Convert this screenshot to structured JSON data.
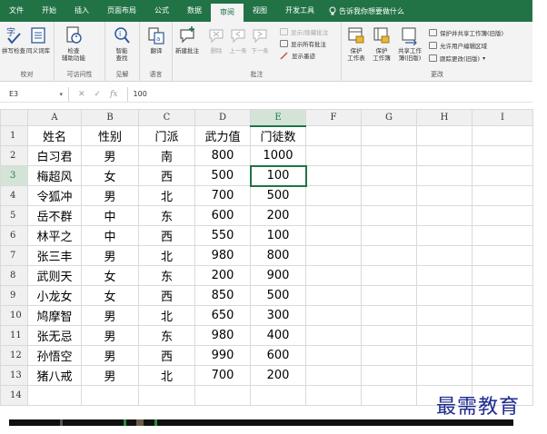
{
  "tabs": [
    "文件",
    "开始",
    "插入",
    "页面布局",
    "公式",
    "数据",
    "审阅",
    "视图",
    "开发工具"
  ],
  "active_tab": "审阅",
  "tell_me": "告诉我你想要做什么",
  "ribbon": {
    "proofing": {
      "label": "校对",
      "spell": "拼写检查",
      "thesaurus": "同义词库"
    },
    "accessibility": {
      "label": "可访问性",
      "check_line1": "检查",
      "check_line2": "辅助功能"
    },
    "insights": {
      "label": "见解",
      "smart_line1": "智能",
      "smart_line2": "查找"
    },
    "language": {
      "label": "语言",
      "translate": "翻译"
    },
    "comments": {
      "label": "批注",
      "new": "新建批注",
      "delete": "删除",
      "prev": "上一条",
      "next": "下一条",
      "show_hide": "显示/隐藏批注",
      "show_all": "显示所有批注",
      "show_ink": "显示墨迹"
    },
    "changes": {
      "label": "更改",
      "protect_sheet_line1": "保护",
      "protect_sheet_line2": "工作表",
      "protect_wb_line1": "保护",
      "protect_wb_line2": "工作簿",
      "share_line1": "共享工作",
      "share_line2": "簿(旧版)",
      "protect_share": "保护并共享工作簿(旧版)",
      "allow_edit": "允许用户编辑区域",
      "track": "跟踪更改(旧版)"
    }
  },
  "formula_bar": {
    "name_box": "E3",
    "value": "100",
    "fx": "fx"
  },
  "columns": [
    "A",
    "B",
    "C",
    "D",
    "E",
    "F",
    "G",
    "H",
    "I"
  ],
  "rows": [
    [
      "姓名",
      "性别",
      "门派",
      "武力值",
      "门徒数"
    ],
    [
      "白习君",
      "男",
      "南",
      "800",
      "1000"
    ],
    [
      "梅超风",
      "女",
      "西",
      "500",
      "100"
    ],
    [
      "令狐冲",
      "男",
      "北",
      "700",
      "500"
    ],
    [
      "岳不群",
      "中",
      "东",
      "600",
      "200"
    ],
    [
      "林平之",
      "中",
      "西",
      "550",
      "100"
    ],
    [
      "张三丰",
      "男",
      "北",
      "980",
      "800"
    ],
    [
      "武则天",
      "女",
      "东",
      "200",
      "900"
    ],
    [
      "小龙女",
      "女",
      "西",
      "850",
      "500"
    ],
    [
      "鸠摩智",
      "男",
      "北",
      "650",
      "300"
    ],
    [
      "张无忌",
      "男",
      "东",
      "980",
      "400"
    ],
    [
      "孙悟空",
      "男",
      "西",
      "990",
      "600"
    ],
    [
      "猪八戒",
      "男",
      "北",
      "700",
      "200"
    ],
    [
      "",
      "",
      "",
      "",
      ""
    ]
  ],
  "watermark": "最需教育",
  "colors": {
    "accent": "#217346",
    "watermark": "#1e2a8e"
  }
}
